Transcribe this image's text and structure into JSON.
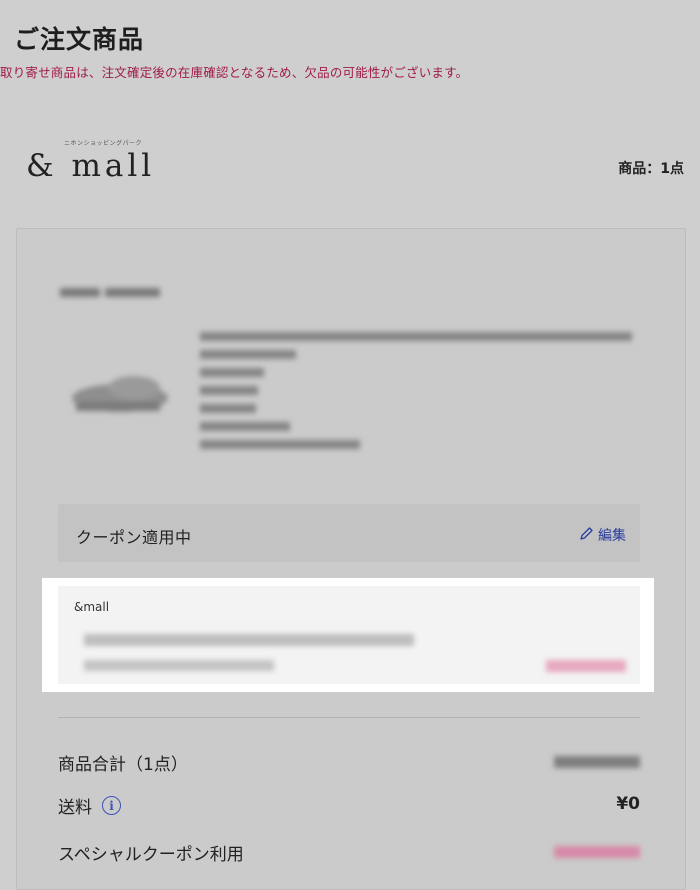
{
  "header": {
    "title": "ご注文商品",
    "notice": "取り寄せ商品は、注文確定後の在庫確認となるため、欠品の可能性がございます。"
  },
  "store": {
    "logo_sub": "ニホンショッピングパーク",
    "logo_main": "& mall",
    "item_count": "商品：1点"
  },
  "coupon": {
    "label": "クーポン適用中",
    "edit_label": "編集",
    "store_name": "&mall"
  },
  "summary": {
    "subtotal_label": "商品合計（1点）",
    "shipping_label": "送料",
    "shipping_value": "¥0",
    "special_coupon_label": "スペシャルクーポン利用"
  },
  "colors": {
    "notice": "#a01a4a",
    "link": "#2a3d9e",
    "discount": "#d9668e"
  }
}
